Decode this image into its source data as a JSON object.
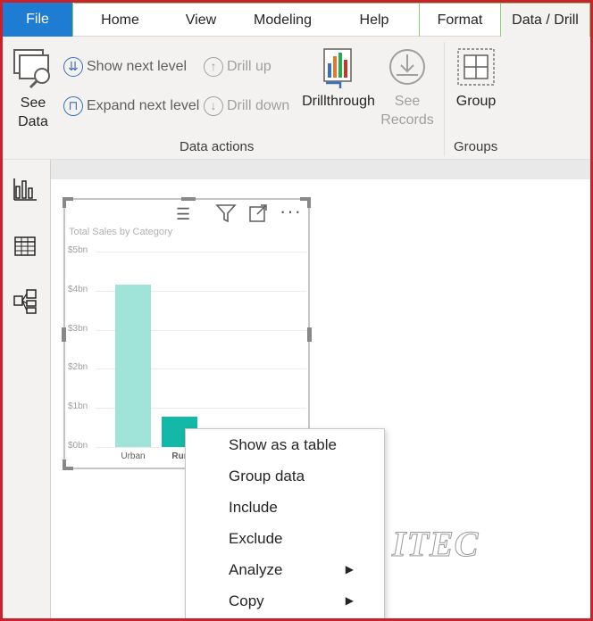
{
  "tabs": [
    {
      "label": "File"
    },
    {
      "label": "Home"
    },
    {
      "label": "View"
    },
    {
      "label": "Modeling"
    },
    {
      "label": "Help"
    },
    {
      "label": "Format"
    },
    {
      "label": "Data / Drill"
    }
  ],
  "ribbon": {
    "see_data": "See\nData",
    "see_data_l1": "See",
    "see_data_l2": "Data",
    "show_next_level": "Show next level",
    "expand_next_level": "Expand next level",
    "drill_up": "Drill up",
    "drill_down": "Drill down",
    "drillthrough": "Drillthrough",
    "see_records_l1": "See",
    "see_records_l2": "Records",
    "group": "Group",
    "data_actions_label": "Data actions",
    "groups_label": "Groups"
  },
  "visual": {
    "title": "Total Sales by Category"
  },
  "chart_data": {
    "type": "bar",
    "title": "Total Sales by Category",
    "categories": [
      "Urban",
      "Rural"
    ],
    "category_labels_visible": [
      "Urban",
      "Rur"
    ],
    "values": [
      4.15,
      0.78
    ],
    "value_unit": "bn",
    "y_ticks": [
      "$0bn",
      "$1bn",
      "$2bn",
      "$3bn",
      "$4bn",
      "$5bn"
    ],
    "ylim": [
      0,
      5
    ],
    "colors": [
      "#9fe3d9",
      "#14b8a6"
    ],
    "grid": true
  },
  "context_menu": {
    "items": [
      {
        "label": "Show as a table",
        "submenu": false
      },
      {
        "label": "Group data",
        "submenu": false
      },
      {
        "label": "Include",
        "submenu": false
      },
      {
        "label": "Exclude",
        "submenu": false
      },
      {
        "label": "Analyze",
        "submenu": true
      },
      {
        "label": "Copy",
        "submenu": true
      }
    ],
    "submenu_arrow": "▶"
  },
  "watermark": "ITEC",
  "colors": {
    "file_tab": "#1f7cd3",
    "frame_border": "#c8232c",
    "ribbon_bg": "#f3f2f1"
  }
}
